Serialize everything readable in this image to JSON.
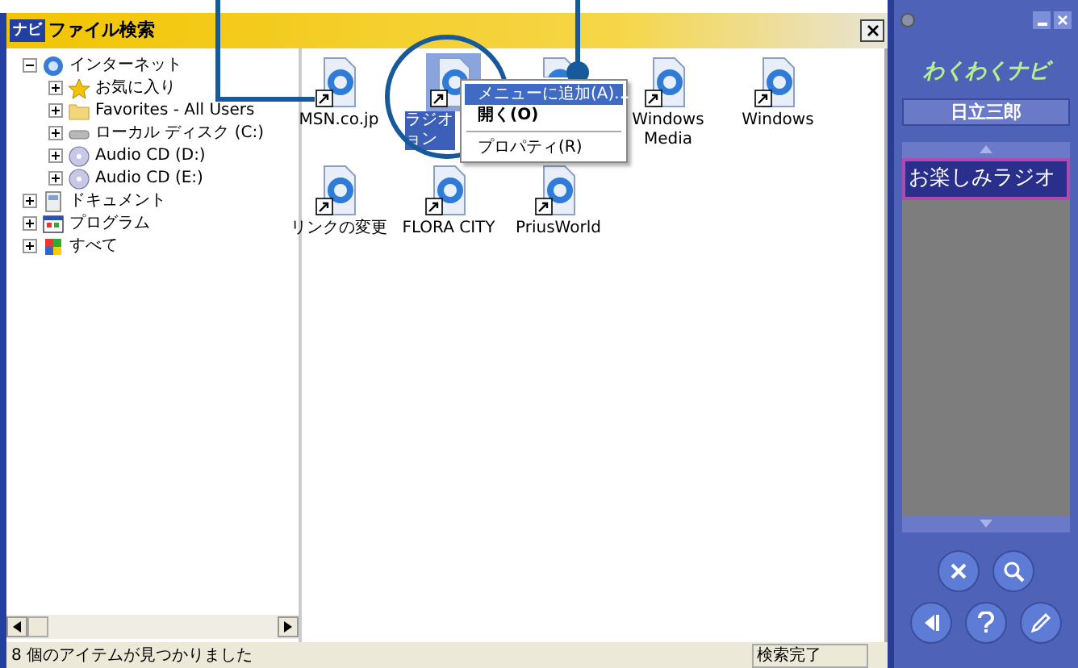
{
  "window": {
    "logo": "ナビ",
    "title": "ファイル検索"
  },
  "tree": [
    {
      "label": "インターネット",
      "kind": "globe",
      "expanded": true,
      "children": [
        {
          "label": "お気に入り",
          "kind": "star",
          "expanded": false
        },
        {
          "label": "Favorites - All Users",
          "kind": "folder",
          "expanded": false
        },
        {
          "label": "ローカル ディスク (C:)",
          "kind": "drive",
          "expanded": false
        },
        {
          "label": "Audio CD (D:)",
          "kind": "cd",
          "expanded": false
        },
        {
          "label": "Audio CD (E:)",
          "kind": "cd",
          "expanded": false
        }
      ]
    },
    {
      "label": "ドキュメント",
      "kind": "document",
      "expanded": false
    },
    {
      "label": "プログラム",
      "kind": "program",
      "expanded": false
    },
    {
      "label": "すべて",
      "kind": "all",
      "expanded": false
    }
  ],
  "files": [
    {
      "label": "MSN.co.jp",
      "selected": false
    },
    {
      "label": "ラジオョン",
      "selected": true
    },
    {
      "kind": "covered",
      "selected": false
    },
    {
      "label": "Windows Media",
      "selected": false
    },
    {
      "label": "Windows",
      "selected": false
    },
    {
      "label": "リンクの変更",
      "selected": false
    },
    {
      "label": "FLORA CITY",
      "selected": false
    },
    {
      "label": "PriusWorld",
      "selected": false
    }
  ],
  "context_menu": [
    {
      "label": "メニューに追加(A)...",
      "kind": "item",
      "selected": true
    },
    {
      "label": "開く(O)",
      "kind": "default",
      "selected": false
    },
    {
      "kind": "separator"
    },
    {
      "label": "プロパティ(R)",
      "kind": "item",
      "selected": false
    }
  ],
  "status_bar": {
    "message": "8 個のアイテムが見つかりました",
    "state": "検索完了"
  },
  "side_panel": {
    "logo": "わくわくナビ",
    "user": "日立三郎",
    "menu": [
      {
        "label": "お楽しみラジオ",
        "selected": true
      }
    ]
  }
}
